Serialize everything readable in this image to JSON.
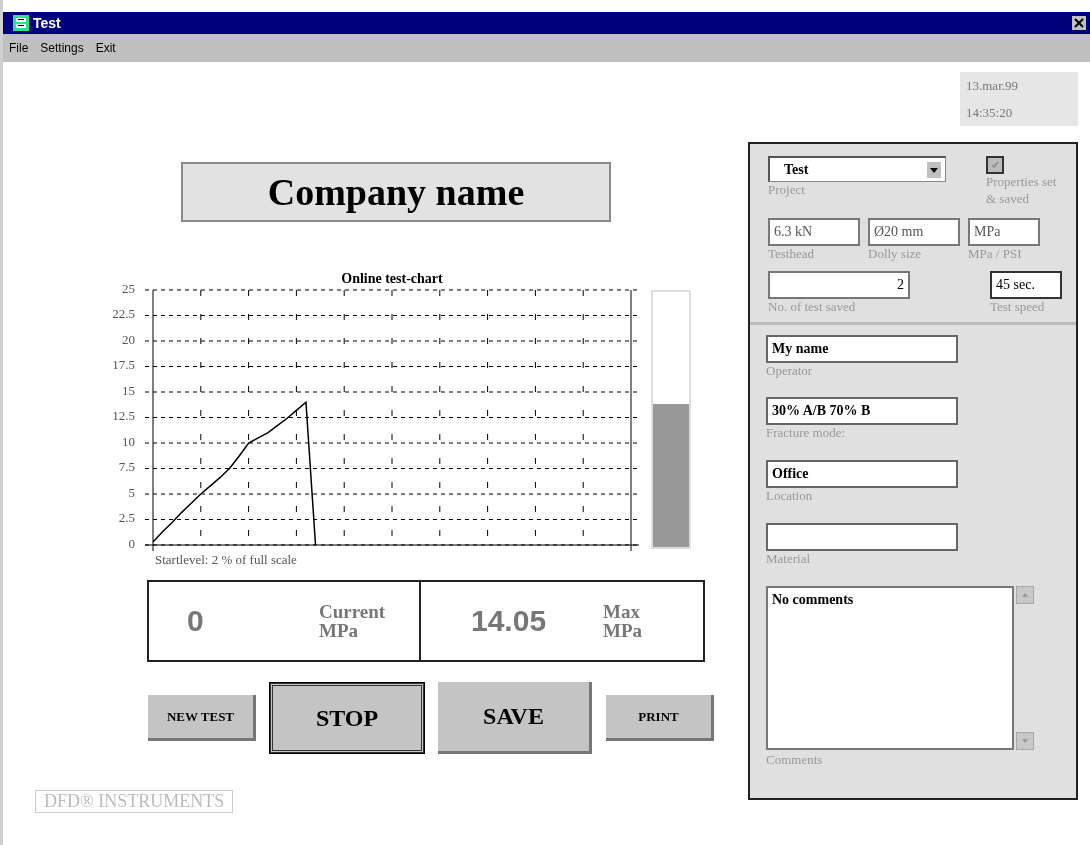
{
  "window": {
    "title": "Test"
  },
  "menu": [
    "File",
    "Settings",
    "Exit"
  ],
  "datetime": {
    "date": "13.mar.99",
    "time": "14:35:20"
  },
  "company": "Company name",
  "chart": {
    "chart_data": {
      "type": "line",
      "title": "Online test-chart",
      "grid": true,
      "ylim": [
        0,
        25
      ],
      "yticks": [
        0,
        2.5,
        5,
        7.5,
        10,
        12.5,
        15,
        17.5,
        20,
        22.5,
        25
      ],
      "categories": [
        null,
        null,
        null,
        null,
        null,
        null,
        null,
        null,
        null,
        null,
        null,
        null,
        null,
        null,
        null,
        null,
        null,
        null,
        null,
        null,
        null,
        null,
        null,
        null,
        null,
        null,
        null,
        null,
        null,
        null,
        null,
        null,
        null,
        null,
        null,
        null,
        null,
        null,
        null,
        null,
        null,
        null,
        null,
        null,
        null,
        null,
        null,
        null,
        null,
        null,
        null
      ],
      "series": [
        {
          "color": "#000000",
          "values": [
            0.3,
            1.3,
            2.2,
            3.2,
            4.1,
            5,
            5.8,
            6.6,
            7.5,
            8.7,
            10,
            10.5,
            11,
            11.7,
            12.4,
            13.2,
            14,
            0,
            null,
            null,
            null,
            null,
            null,
            null,
            null,
            null,
            null,
            null,
            null,
            null,
            null,
            null,
            null,
            null,
            null,
            null,
            null,
            null,
            null,
            null,
            null,
            null,
            null,
            null,
            null,
            null,
            null,
            null,
            null,
            null,
            null
          ]
        }
      ]
    },
    "startlevel": "Startlevel:   2 % of full scale"
  },
  "meter": {
    "level": 0.56
  },
  "readouts": [
    {
      "value": "0",
      "label": "Current MPa"
    },
    {
      "value": "14.05",
      "label": "Max MPa"
    }
  ],
  "buttons": [
    {
      "label": "NEW TEST",
      "kind": "small"
    },
    {
      "label": "STOP",
      "kind": "pressed"
    },
    {
      "label": "SAVE",
      "kind": "large"
    },
    {
      "label": "PRINT",
      "kind": "small"
    }
  ],
  "logo": "DFD® INSTRUMENTS",
  "panel": {
    "project": {
      "value": "Test",
      "label": "Project"
    },
    "properties": {
      "label": "Properties set & saved",
      "checked": true
    },
    "settings": [
      {
        "value": "6.3 kN",
        "label": "Testhead"
      },
      {
        "value": "Ø20  mm",
        "label": "Dolly size"
      },
      {
        "value": "MPa",
        "label": "MPa / PSI"
      }
    ],
    "tests_saved": {
      "value": "2",
      "label": "No. of test saved"
    },
    "speed": {
      "value": "45 sec.",
      "label": "Test speed"
    },
    "fields": [
      {
        "value": "My name",
        "label": "Operator"
      },
      {
        "value": "30% A/B 70% B",
        "label": "Fracture mode:"
      },
      {
        "value": "Office",
        "label": "Location"
      },
      {
        "label": "Material"
      }
    ],
    "comments": {
      "value": "No comments",
      "label": "Comments"
    }
  }
}
